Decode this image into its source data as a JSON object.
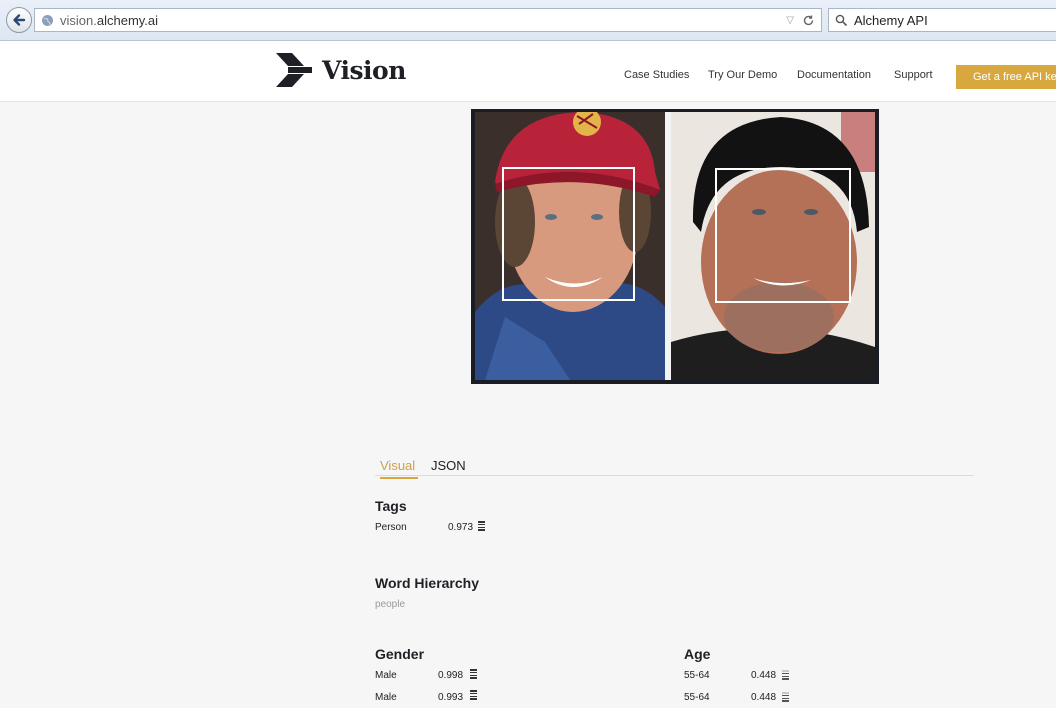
{
  "browser": {
    "url_host": "vision.",
    "url_domain": "alchemy.ai",
    "search_text": "Alchemy API"
  },
  "header": {
    "logo_text": "Vision",
    "nav": [
      "Case Studies",
      "Try Our Demo",
      "Documentation",
      "Support"
    ],
    "cta_label": "Get a free API key"
  },
  "tabs": {
    "visual": "Visual",
    "json": "JSON"
  },
  "tags": {
    "title": "Tags",
    "items": [
      {
        "label": "Person",
        "score": "0.973"
      }
    ]
  },
  "hierarchy": {
    "title": "Word Hierarchy",
    "value": "people"
  },
  "gender": {
    "title": "Gender",
    "rows": [
      {
        "label": "Male",
        "score": "0.998"
      },
      {
        "label": "Male",
        "score": "0.993"
      }
    ]
  },
  "age": {
    "title": "Age",
    "rows": [
      {
        "label": "55-64",
        "score": "0.448"
      },
      {
        "label": "55-64",
        "score": "0.448"
      }
    ]
  },
  "colors": {
    "accent": "#d8a83e",
    "text": "#222222"
  }
}
